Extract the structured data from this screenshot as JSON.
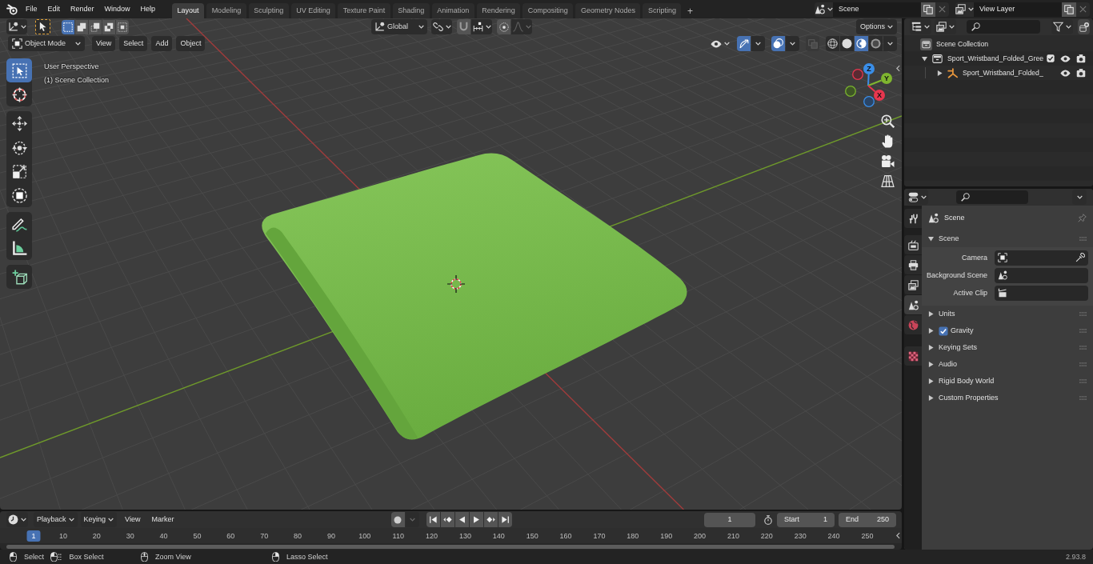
{
  "topbar": {
    "menus": [
      "File",
      "Edit",
      "Render",
      "Window",
      "Help"
    ],
    "workspaces": [
      {
        "label": "Layout",
        "selected": true
      },
      {
        "label": "Modeling",
        "selected": false
      },
      {
        "label": "Sculpting",
        "selected": false
      },
      {
        "label": "UV Editing",
        "selected": false
      },
      {
        "label": "Texture Paint",
        "selected": false
      },
      {
        "label": "Shading",
        "selected": false
      },
      {
        "label": "Animation",
        "selected": false
      },
      {
        "label": "Rendering",
        "selected": false
      },
      {
        "label": "Compositing",
        "selected": false
      },
      {
        "label": "Geometry Nodes",
        "selected": false
      },
      {
        "label": "Scripting",
        "selected": false
      }
    ],
    "add_workspace": "+",
    "scene": "Scene",
    "view_layer": "View Layer"
  },
  "viewport": {
    "tool_settings": {
      "select_modes": [
        {
          "kind": "set",
          "selected": true
        },
        {
          "kind": "extend",
          "selected": false
        },
        {
          "kind": "subtract",
          "selected": false
        },
        {
          "kind": "difference",
          "selected": false
        },
        {
          "kind": "intersect",
          "selected": false
        }
      ],
      "orientation": "Global",
      "snap": {
        "on": false
      },
      "proportional": {
        "on": false
      },
      "falloff": {
        "disabled": true
      },
      "options": "Options"
    },
    "header": {
      "mode": "Object Mode",
      "menus": [
        "View",
        "Select",
        "Add",
        "Object"
      ],
      "gizmos": {
        "on": true
      },
      "overlays": {
        "on": true
      },
      "xray": {
        "on": false
      },
      "shading": [
        {
          "kind": "wireframe",
          "selected": false
        },
        {
          "kind": "solid",
          "selected": false
        },
        {
          "kind": "material",
          "selected": true
        },
        {
          "kind": "rendered",
          "selected": false
        }
      ]
    },
    "tool_groups": [
      [
        {
          "kind": "select",
          "selected": true
        },
        {
          "kind": "cursor",
          "selected": false
        }
      ],
      [
        {
          "kind": "move",
          "selected": false
        },
        {
          "kind": "rotate",
          "selected": false
        },
        {
          "kind": "scale",
          "selected": false
        },
        {
          "kind": "transform",
          "selected": false
        }
      ],
      [
        {
          "kind": "annotate",
          "selected": false
        },
        {
          "kind": "measure",
          "selected": false
        }
      ],
      [
        {
          "kind": "add",
          "selected": false
        }
      ]
    ],
    "info": [
      "User Perspective",
      "(1) Scene Collection"
    ],
    "gizmo": {
      "x": "X",
      "y": "Y",
      "z": "Z"
    }
  },
  "outliner": {
    "tree": [
      {
        "label": "Scene Collection",
        "kind": "scene",
        "children": [
          {
            "label": "Sport_Wristband_Folded_Gree",
            "kind": "collection",
            "expanded": true,
            "checked": true,
            "visible": true,
            "renderable": true,
            "children": [
              {
                "label": "Sport_Wristband_Folded_",
                "kind": "object",
                "expanded": false,
                "visible": true,
                "renderable": true
              }
            ]
          }
        ]
      }
    ]
  },
  "properties": {
    "tab_groups": [
      [
        {
          "kind": "tool",
          "selected": false
        }
      ],
      [
        {
          "kind": "render",
          "selected": false
        },
        {
          "kind": "output",
          "selected": false
        },
        {
          "kind": "view_layer",
          "selected": false
        },
        {
          "kind": "scene",
          "selected": true
        },
        {
          "kind": "world",
          "selected": false
        }
      ],
      [
        {
          "kind": "texture",
          "selected": false
        }
      ]
    ],
    "context": "Scene",
    "panel": {
      "title": "Scene",
      "expanded": true,
      "fields": [
        {
          "label": "Camera",
          "kind": "camera"
        },
        {
          "label": "Background Scene",
          "kind": "scene"
        },
        {
          "label": "Active Clip",
          "kind": "clip"
        }
      ]
    },
    "subpanels": [
      {
        "title": "Units",
        "expanded": false
      },
      {
        "title": "Gravity",
        "expanded": false,
        "toggle": {
          "checked": true
        }
      },
      {
        "title": "Keying Sets",
        "expanded": false
      },
      {
        "title": "Audio",
        "expanded": false
      },
      {
        "title": "Rigid Body World",
        "expanded": false
      },
      {
        "title": "Custom Properties",
        "expanded": false
      }
    ]
  },
  "timeline": {
    "menus": [
      {
        "label": "Playback",
        "dropdown": true
      },
      {
        "label": "Keying",
        "dropdown": true
      },
      {
        "label": "View",
        "dropdown": false
      },
      {
        "label": "Marker",
        "dropdown": false
      }
    ],
    "auto_keying": {
      "on": false
    },
    "current_frame": "1",
    "start": {
      "label": "Start",
      "value": "1"
    },
    "end": {
      "label": "End",
      "value": "250"
    },
    "ruler": [
      {
        "label": "1",
        "selected": true
      },
      {
        "label": "10",
        "selected": false
      },
      {
        "label": "20",
        "selected": false
      },
      {
        "label": "30",
        "selected": false
      },
      {
        "label": "40",
        "selected": false
      },
      {
        "label": "50",
        "selected": false
      },
      {
        "label": "60",
        "selected": false
      },
      {
        "label": "70",
        "selected": false
      },
      {
        "label": "80",
        "selected": false
      },
      {
        "label": "90",
        "selected": false
      },
      {
        "label": "100",
        "selected": false
      },
      {
        "label": "110",
        "selected": false
      },
      {
        "label": "120",
        "selected": false
      },
      {
        "label": "130",
        "selected": false
      },
      {
        "label": "140",
        "selected": false
      },
      {
        "label": "150",
        "selected": false
      },
      {
        "label": "160",
        "selected": false
      },
      {
        "label": "170",
        "selected": false
      },
      {
        "label": "180",
        "selected": false
      },
      {
        "label": "190",
        "selected": false
      },
      {
        "label": "200",
        "selected": false
      },
      {
        "label": "210",
        "selected": false
      },
      {
        "label": "220",
        "selected": false
      },
      {
        "label": "230",
        "selected": false
      },
      {
        "label": "240",
        "selected": false
      },
      {
        "label": "250",
        "selected": false
      }
    ]
  },
  "status_bar": {
    "hints": [
      {
        "kind": "left",
        "label": "Select"
      },
      {
        "kind": "drag",
        "label": "Box Select"
      },
      {
        "kind": "middle",
        "label": "Zoom View"
      },
      {
        "kind": "right",
        "label": "Lasso Select"
      }
    ],
    "version": "2.93.8"
  }
}
